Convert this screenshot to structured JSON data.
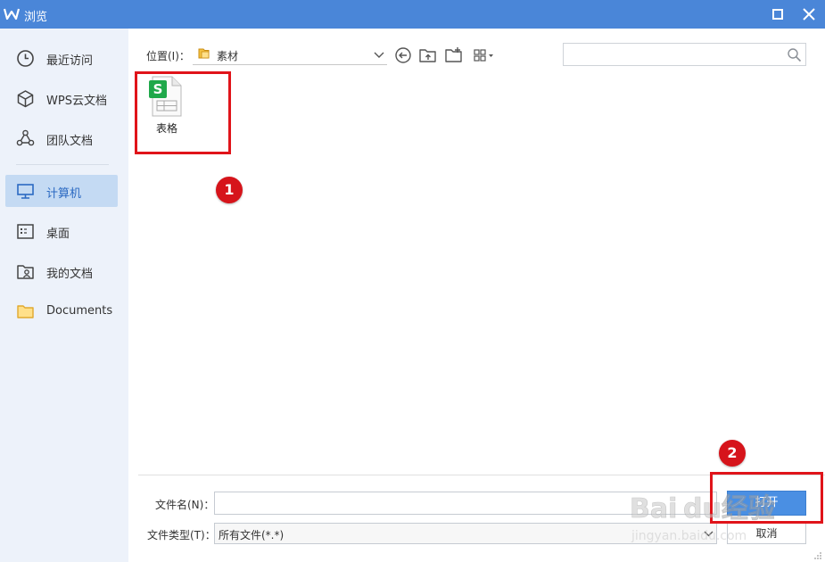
{
  "window": {
    "title": "浏览",
    "accent_color": "#4a86d8",
    "logo_icon": "wps-logo-icon",
    "maximize_icon": "maximize-icon",
    "close_icon": "close-icon"
  },
  "sidebar": {
    "items": [
      {
        "label": "最近访问",
        "icon": "clock-icon",
        "active": false
      },
      {
        "label": "WPS云文档",
        "icon": "cube-icon",
        "active": false
      },
      {
        "label": "团队文档",
        "icon": "team-icon",
        "active": false
      },
      {
        "label": "计算机",
        "icon": "monitor-icon",
        "active": true
      },
      {
        "label": "桌面",
        "icon": "desktop-icon",
        "active": false
      },
      {
        "label": "我的文档",
        "icon": "my-documents-icon",
        "active": false
      },
      {
        "label": "Documents",
        "icon": "folder-icon",
        "active": false
      }
    ]
  },
  "toolbar": {
    "location_label": "位置(I)：",
    "location_value": "素材",
    "back_icon": "back-arrow-icon",
    "up_folder_icon": "up-folder-icon",
    "new_folder_icon": "new-folder-icon",
    "view_icon": "grid-view-icon",
    "search_placeholder": "",
    "search_icon": "search-icon"
  },
  "files": [
    {
      "name": "表格",
      "icon": "spreadsheet-file-icon"
    }
  ],
  "annotations": {
    "badge1": "1",
    "badge2": "2",
    "highlight_color": "#e0141a"
  },
  "footer": {
    "filename_label": "文件名(N)：",
    "filename_value": "",
    "filetype_label": "文件类型(T)：",
    "filetype_value": "所有文件(*.*)",
    "open_label": "打开",
    "cancel_label": "取消",
    "open_button_color": "#4a8fe3"
  },
  "watermark": {
    "text": "Baidu经验",
    "subtext": "jingyan.baidu.com"
  }
}
